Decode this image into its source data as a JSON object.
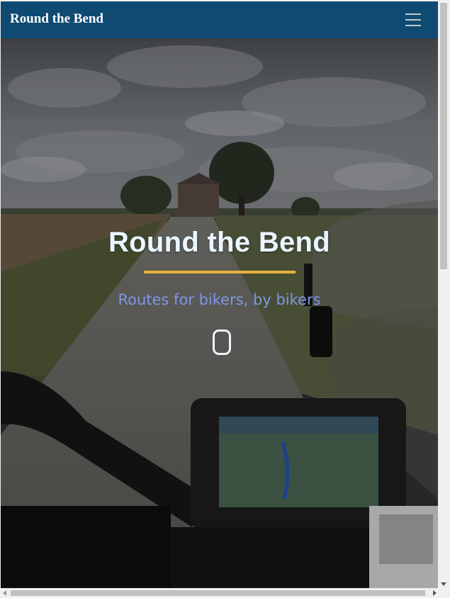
{
  "navbar": {
    "brand": "Round the Bend",
    "menu_icon": "hamburger-menu-icon"
  },
  "hero": {
    "title": "Round the Bend",
    "subtitle": "Routes for bikers, by bikers",
    "scroll_icon": "mouse-scroll-icon",
    "background_image": "country-road-motorcycle-view"
  },
  "colors": {
    "navbar": "#0e4a72",
    "accent_rule": "#e8b13c",
    "subtitle": "#7d97e6",
    "title": "#eaf6ff"
  }
}
